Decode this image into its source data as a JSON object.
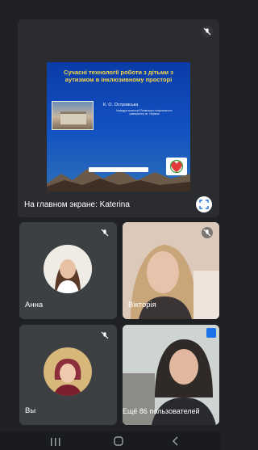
{
  "presentation": {
    "slide_title": "Сучасні технології роботи з дітьми з аутизмом в інклюзивному просторі",
    "slide_author": "К. О. Островська",
    "slide_affiliation": "Кафедра психології Львівського національного університету ім. І.Франка",
    "label": "На главном экране: Katerina"
  },
  "participants": [
    {
      "name": "Анна"
    },
    {
      "name": "Вікторія"
    },
    {
      "name": "Вы"
    },
    {
      "name": "Ещё 86 пользователей"
    }
  ],
  "icons": {
    "mic_off": "mic-off-icon",
    "expand": "expand-icon",
    "nav_recents": "recents-icon",
    "nav_home": "home-icon",
    "nav_back": "back-icon"
  },
  "colors": {
    "background": "#202124",
    "tile": "#3c4043",
    "slide_blue": "#1353c2",
    "slide_title": "#f6d84a"
  }
}
